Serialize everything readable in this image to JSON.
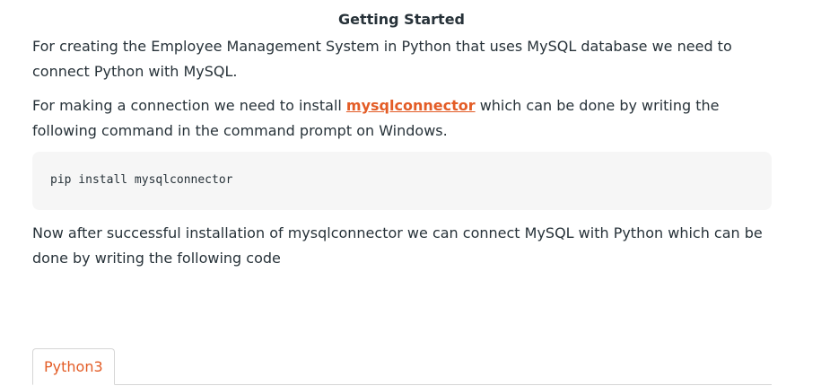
{
  "article": {
    "heading": "Getting Started",
    "para1": "For creating the Employee Management System in Python that uses MySQL database we need to connect Python with MySQL.",
    "para2_before": "For making a connection we need to install ",
    "para2_link": "mysqlconnector",
    "para2_after": " which can be done by writing the following command in the command prompt on Windows.",
    "code": "pip install mysqlconnector",
    "para3": "Now after successful installation of mysqlconnector we can connect MySQL with Python which can be done by writing the following code"
  },
  "code_tabs": {
    "active_tab": "Python3"
  },
  "colors": {
    "link": "#e35c26",
    "text": "#273239",
    "code_bg": "#f6f6f6",
    "tab_border": "#d5d5d5"
  }
}
